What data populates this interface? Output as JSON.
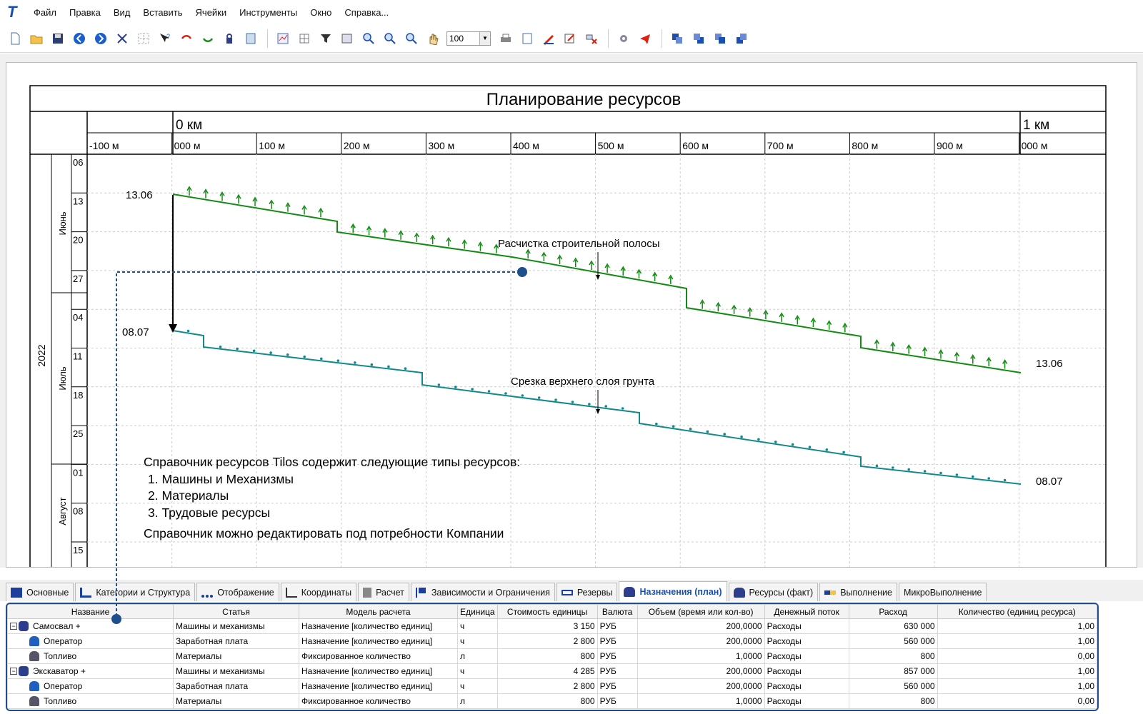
{
  "menu": [
    "Файл",
    "Правка",
    "Вид",
    "Вставить",
    "Ячейки",
    "Инструменты",
    "Окно",
    "Справка..."
  ],
  "toolbar": {
    "zoom_value": "100"
  },
  "chart": {
    "title": "Планирование ресурсов",
    "km_labels": [
      "0 км",
      "1 км"
    ],
    "m_labels": [
      "-100 м",
      "000 м",
      "100 м",
      "200 м",
      "300 м",
      "400 м",
      "500 м",
      "600 м",
      "700 м",
      "800 м",
      "900 м",
      "000 м"
    ],
    "year": "2022",
    "months": [
      "Июнь",
      "Июль",
      "Август"
    ],
    "days": [
      "06",
      "13",
      "20",
      "27",
      "04",
      "11",
      "18",
      "25",
      "01",
      "08",
      "15"
    ],
    "task1": {
      "label": "Расчистка строительной полосы",
      "start_date": "13.06",
      "end_date": "13.06",
      "color": "#138a13"
    },
    "task2": {
      "label": "Срезка верхнего слоя грунта",
      "start_date": "08.07",
      "end_date": "08.07",
      "color": "#14898a"
    },
    "note_title": "Справочник ресурсов Tilos содержит следующие типы ресурсов:",
    "note_items": [
      "1. Машины и Механизмы",
      "2. Материалы",
      "3. Трудовые ресурсы"
    ],
    "note_footer": "Справочник можно редактировать под потребности Компании"
  },
  "tabs": [
    "Основные",
    "Категории и Структура",
    "Отображение",
    "Координаты",
    "Расчет",
    "Зависимости и Ограничения",
    "Резервы",
    "Назначения (план)",
    "Ресурсы (факт)",
    "Выполнение",
    "МикроВыполнение"
  ],
  "grid": {
    "columns": [
      "Название",
      "Статья",
      "Модель расчета",
      "Единица",
      "Стоимость единицы",
      "Валюта",
      "Объем (время или кол-во)",
      "Денежный поток",
      "Расход",
      "Количество (единиц ресурса)"
    ],
    "rows": [
      {
        "name": "Самосвал +",
        "article": "Машины и механизмы",
        "model": "Назначение [количество единиц]",
        "unit": "ч",
        "cost": "3 150",
        "currency": "РУБ",
        "volume": "200,0000",
        "flow": "Расходы",
        "expense": "630 000",
        "qty": "1,00"
      },
      {
        "name": "Оператор",
        "article": "Заработная плата",
        "model": "Назначение [количество единиц]",
        "unit": "ч",
        "cost": "2 800",
        "currency": "РУБ",
        "volume": "200,0000",
        "flow": "Расходы",
        "expense": "560 000",
        "qty": "1,00"
      },
      {
        "name": "Топливо",
        "article": "Материалы",
        "model": "Фиксированное количество",
        "unit": "л",
        "cost": "800",
        "currency": "РУБ",
        "volume": "1,0000",
        "flow": "Расходы",
        "expense": "800",
        "qty": "0,00"
      },
      {
        "name": "Экскаватор +",
        "article": "Машины и механизмы",
        "model": "Назначение [количество единиц]",
        "unit": "ч",
        "cost": "4 285",
        "currency": "РУБ",
        "volume": "200,0000",
        "flow": "Расходы",
        "expense": "857 000",
        "qty": "1,00"
      },
      {
        "name": "Оператор",
        "article": "Заработная плата",
        "model": "Назначение [количество единиц]",
        "unit": "ч",
        "cost": "2 800",
        "currency": "РУБ",
        "volume": "200,0000",
        "flow": "Расходы",
        "expense": "560 000",
        "qty": "1,00"
      },
      {
        "name": "Топливо",
        "article": "Материалы",
        "model": "Фиксированное количество",
        "unit": "л",
        "cost": "800",
        "currency": "РУБ",
        "volume": "1,0000",
        "flow": "Расходы",
        "expense": "800",
        "qty": "0,00"
      }
    ]
  }
}
